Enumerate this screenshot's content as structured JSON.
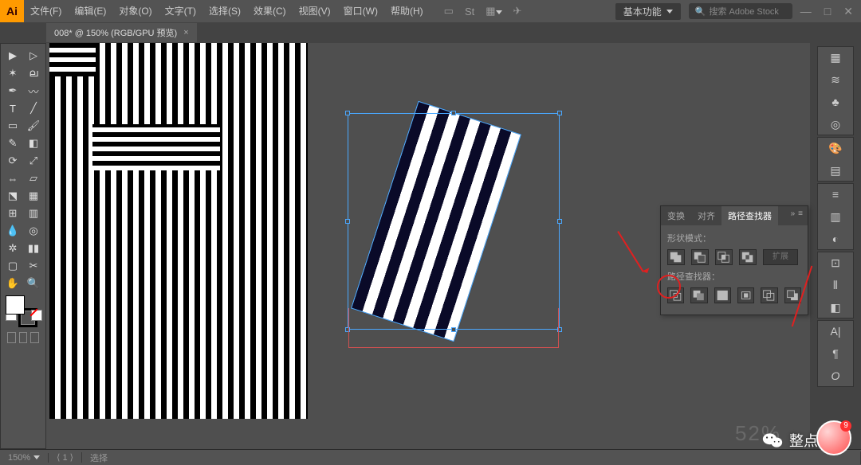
{
  "menu": {
    "file": "文件(F)",
    "edit": "编辑(E)",
    "object": "对象(O)",
    "type": "文字(T)",
    "select": "选择(S)",
    "effect": "效果(C)",
    "view": "视图(V)",
    "window": "窗口(W)",
    "help": "帮助(H)"
  },
  "workspace_label": "基本功能",
  "search_placeholder": "搜索 Adobe Stock",
  "tab": {
    "title": "008* @ 150% (RGB/GPU 预览)",
    "close": "×"
  },
  "pathfinder": {
    "tab_transform": "变换",
    "tab_align": "对齐",
    "tab_pathfinder": "路径查找器",
    "shape_modes_label": "形状模式：",
    "pathfinder_label": "路径查找器：",
    "expand_label": "扩展"
  },
  "status": {
    "zoom": "150%",
    "nav": "⟨ 1 ⟩",
    "tool": "选择"
  },
  "watermark_text": "整点创作",
  "faded_counter": "52%",
  "window_controls": {
    "min": "—",
    "max": "□",
    "close": "✕"
  }
}
